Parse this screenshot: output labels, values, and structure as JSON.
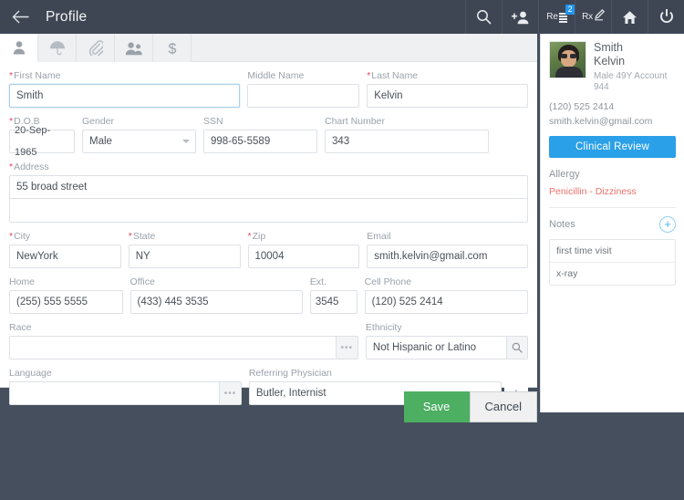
{
  "header": {
    "back_icon": "arrow-left-icon",
    "title": "Profile",
    "icons": [
      {
        "name": "search-icon",
        "label": ""
      },
      {
        "name": "add-person-icon",
        "label": ""
      },
      {
        "name": "referral-icon",
        "label": "Re",
        "badge": "2"
      },
      {
        "name": "prescription-icon",
        "label": "Rx",
        "badge": ""
      },
      {
        "name": "home-icon",
        "label": ""
      },
      {
        "name": "power-icon",
        "label": ""
      }
    ]
  },
  "tabs": [
    {
      "name": "tab-demographics",
      "icon": "person-icon",
      "active": true
    },
    {
      "name": "tab-insurance",
      "icon": "umbrella-icon",
      "active": false
    },
    {
      "name": "tab-attachments",
      "icon": "paperclip-icon",
      "active": false
    },
    {
      "name": "tab-family",
      "icon": "people-icon",
      "active": false
    },
    {
      "name": "tab-billing",
      "icon": "dollar-icon",
      "active": false
    }
  ],
  "form": {
    "first_name": {
      "label": "First Name",
      "required": true,
      "value": "Smith",
      "focused": true
    },
    "middle_name": {
      "label": "Middle Name",
      "required": false,
      "value": ""
    },
    "last_name": {
      "label": "Last Name",
      "required": true,
      "value": "Kelvin"
    },
    "dob": {
      "label": "D.O.B",
      "required": true,
      "value": "20-Sep-1965"
    },
    "gender": {
      "label": "Gender",
      "required": false,
      "value": "Male"
    },
    "ssn": {
      "label": "SSN",
      "required": false,
      "value": "998-65-5589"
    },
    "chart_number": {
      "label": "Chart Number",
      "required": false,
      "value": "343"
    },
    "address": {
      "label": "Address",
      "required": true,
      "line1": "55 broad street",
      "line2": ""
    },
    "city": {
      "label": "City",
      "required": true,
      "value": "NewYork"
    },
    "state": {
      "label": "State",
      "required": true,
      "value": "NY"
    },
    "zip": {
      "label": "Zip",
      "required": true,
      "value": "10004"
    },
    "email": {
      "label": "Email",
      "required": false,
      "value": "smith.kelvin@gmail.com"
    },
    "home": {
      "label": "Home",
      "required": false,
      "value": "(255) 555 5555"
    },
    "office": {
      "label": "Office",
      "required": false,
      "value": "(433) 445 3535"
    },
    "ext": {
      "label": "Ext.",
      "required": false,
      "value": "3545"
    },
    "cell_phone": {
      "label": "Cell Phone",
      "required": false,
      "value": "(120) 525 2414"
    },
    "race": {
      "label": "Race",
      "required": false,
      "value": "",
      "button_icon": "ellipsis-icon"
    },
    "ethnicity": {
      "label": "Ethnicity",
      "required": false,
      "value": "Not Hispanic or Latino",
      "button_icon": "search-icon"
    },
    "language": {
      "label": "Language",
      "required": false,
      "value": "",
      "button_icon": "ellipsis-icon"
    },
    "referring_physician": {
      "label": "Referring Physician",
      "required": false,
      "value": "Butler, Internist",
      "button_icon": "plus-icon"
    }
  },
  "footer": {
    "save_label": "Save",
    "cancel_label": "Cancel"
  },
  "sidebar": {
    "patient": {
      "last_name": "Smith",
      "first_name": "Kelvin",
      "meta": "Male 49Y Account 944",
      "phone": "(120) 525 2414",
      "email": "smith.kelvin@gmail.com",
      "avatar": "patient-photo"
    },
    "clinical_review_label": "Clinical Review",
    "allergy": {
      "heading": "Allergy",
      "value": "Penicillin - Dizziness"
    },
    "notes": {
      "heading": "Notes",
      "add_icon": "plus-icon",
      "items": [
        "first time visit",
        "x-ray"
      ]
    }
  },
  "colors": {
    "header_bg": "#3e4653",
    "app_bg": "#464f5d",
    "accent_blue": "#2aa0e8",
    "save_green": "#4caf62",
    "required_red": "#e8455f",
    "allergy_red": "#e8706a",
    "badge_blue": "#2196f3"
  }
}
